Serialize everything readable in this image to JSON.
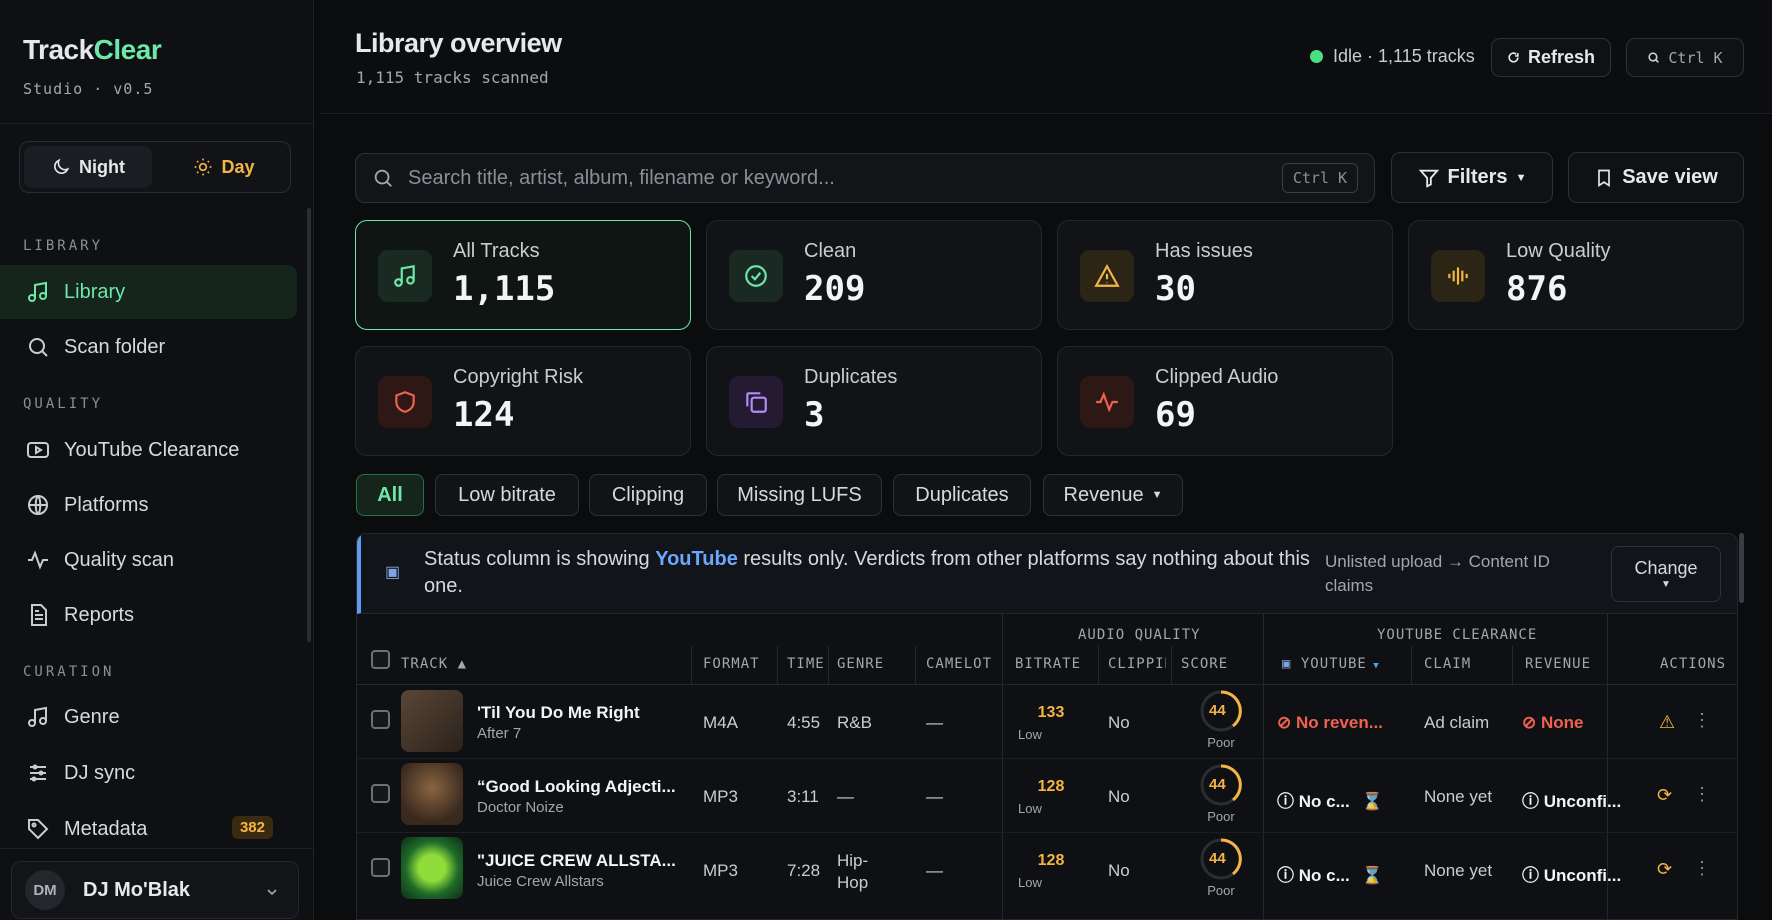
{
  "app": {
    "brand_a": "Track",
    "brand_b": "Clear",
    "version": "Studio · v0.5"
  },
  "modes": {
    "night": "Night",
    "day": "Day"
  },
  "sidebar": {
    "sec_library": "LIBRARY",
    "sec_quality": "QUALITY",
    "sec_curation": "CURATION",
    "items": [
      {
        "label": "Library",
        "icon": "music-note-icon",
        "active": true
      },
      {
        "label": "Scan folder",
        "icon": "search-icon"
      },
      {
        "label": "YouTube Clearance",
        "icon": "play-square-icon"
      },
      {
        "label": "Platforms",
        "icon": "globe-icon"
      },
      {
        "label": "Quality scan",
        "icon": "pulse-icon"
      },
      {
        "label": "Reports",
        "icon": "document-icon"
      },
      {
        "label": "Genre",
        "icon": "music-note-icon"
      },
      {
        "label": "DJ sync",
        "icon": "sliders-icon"
      },
      {
        "label": "Metadata",
        "icon": "tag-icon",
        "badge": "382"
      }
    ],
    "user": {
      "initials": "DM",
      "name": "DJ Mo'Blak"
    }
  },
  "header": {
    "title": "Library overview",
    "subtitle": "1,115 tracks scanned",
    "status": "Idle · 1,115 tracks",
    "refresh": "Refresh",
    "cmdk": "Ctrl K"
  },
  "search": {
    "placeholder": "Search title, artist, album, filename or keyword...",
    "kbd": "Ctrl K",
    "filters": "Filters",
    "save": "Save view"
  },
  "cards": [
    {
      "label": "All Tracks",
      "value": "1,115",
      "icon": "music-note-icon",
      "color": "#6ee7a8"
    },
    {
      "label": "Clean",
      "value": "209",
      "icon": "check-circle-icon",
      "color": "#6ee7a8"
    },
    {
      "label": "Has issues",
      "value": "30",
      "icon": "warning-icon",
      "color": "#f5b544"
    },
    {
      "label": "Low Quality",
      "value": "876",
      "icon": "waveform-icon",
      "color": "#f5b544"
    },
    {
      "label": "Copyright Risk",
      "value": "124",
      "icon": "shield-icon",
      "color": "#f0614f"
    },
    {
      "label": "Duplicates",
      "value": "3",
      "icon": "copy-icon",
      "color": "#b48cf5"
    },
    {
      "label": "Clipped Audio",
      "value": "69",
      "icon": "pulse-icon",
      "color": "#f0614f"
    }
  ],
  "chips": [
    "All",
    "Low bitrate",
    "Clipping",
    "Missing LUFS",
    "Duplicates",
    "Revenue"
  ],
  "banner": {
    "pre": "Status column is showing ",
    "platform": "YouTube",
    "post": " results only. Verdicts from other platforms say nothing about this one.",
    "side": "Unlisted upload → Content ID claims",
    "change": "Change"
  },
  "table": {
    "groups": {
      "audio": "AUDIO QUALITY",
      "youtube": "YOUTUBE CLEARANCE"
    },
    "headers": {
      "track": "TRACK ▲",
      "format": "FORMAT",
      "time": "TIME",
      "genre": "GENRE",
      "camelot": "CAMELOT",
      "bitrate": "BITRATE",
      "clipping": "CLIPPING",
      "score": "SCORE",
      "youtube": "YOUTUBE",
      "claim": "CLAIM",
      "revenue": "REVENUE",
      "actions": "ACTIONS"
    },
    "rows": [
      {
        "title": "'Til You Do Me Right",
        "artist": "After 7",
        "format": "M4A",
        "time": "4:55",
        "genre": "R&B",
        "camelot": "—",
        "bitrate": "133",
        "bitrate_label": "Low",
        "clipping": "No",
        "score": "44",
        "score_label": "Poor",
        "youtube": "No reven...",
        "claim": "Ad claim",
        "revenue": "None",
        "thumb_color": "#4a3a2e"
      },
      {
        "title": "“Good Looking Adjecti...",
        "artist": "Doctor Noize",
        "format": "MP3",
        "time": "3:11",
        "genre": "—",
        "camelot": "—",
        "bitrate": "128",
        "bitrate_label": "Low",
        "clipping": "No",
        "score": "44",
        "score_label": "Poor",
        "youtube": "No c...",
        "claim": "None yet",
        "revenue": "Unconfi...",
        "thumb_color": "#6b4a2e"
      },
      {
        "title": "\"JUICE CREW ALLSTA...",
        "artist": "Juice Crew Allstars",
        "format": "MP3",
        "time": "7:28",
        "genre": "Hip-Hop",
        "camelot": "—",
        "bitrate": "128",
        "bitrate_label": "Low",
        "clipping": "No",
        "score": "44",
        "score_label": "Poor",
        "youtube": "No c...",
        "claim": "None yet",
        "revenue": "Unconfi...",
        "thumb_color": "#2e7a3a"
      }
    ]
  }
}
